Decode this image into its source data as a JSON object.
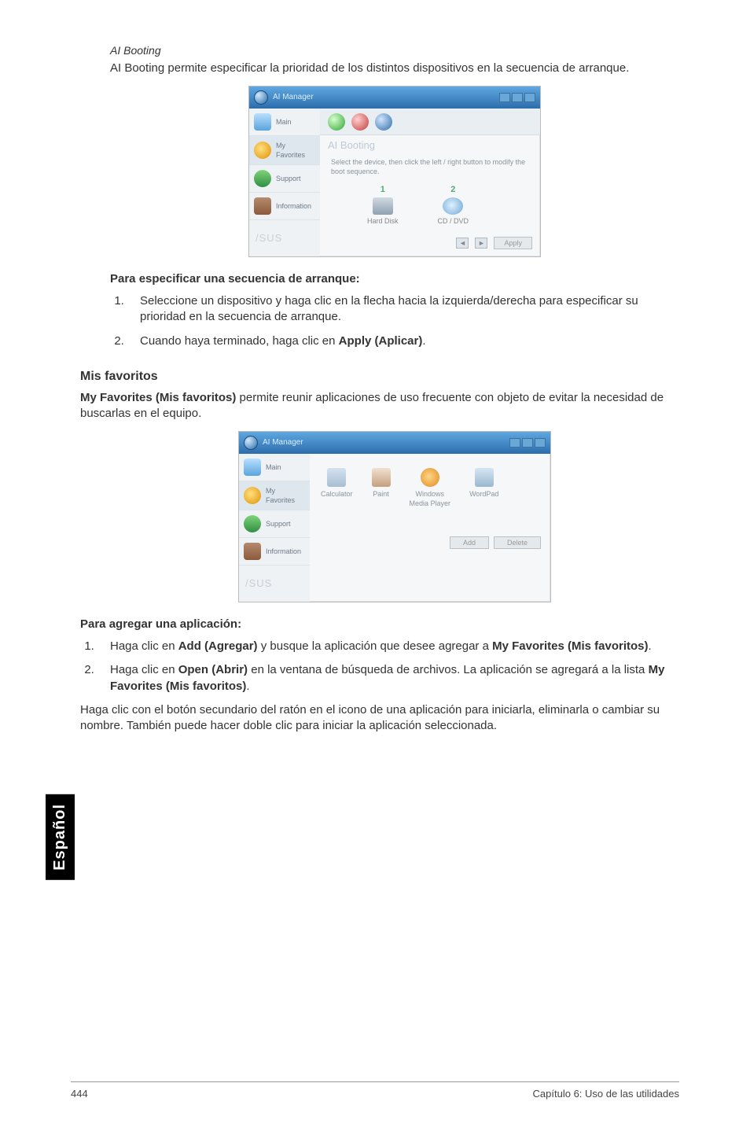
{
  "ai_booting": {
    "heading": "AI Booting",
    "intro": "AI Booting permite especificar la prioridad de los distintos dispositivos en la secuencia de arranque.",
    "figure": {
      "window_title": "AI Manager",
      "sidebar": {
        "main": "Main",
        "favorites_line1": "My",
        "favorites_line2": "Favorites",
        "support": "Support",
        "information": "Information"
      },
      "brand": "/SUS",
      "panel_title": "AI Booting",
      "hint": "Select the device, then click the left / right button to modify the boot sequence.",
      "col1_num": "1",
      "col2_num": "2",
      "dev1": "Hard Disk",
      "dev2": "CD / DVD",
      "arrow_left": "◄",
      "arrow_right": "►",
      "apply": "Apply"
    },
    "steps_heading": "Para especificar una secuencia de arranque:",
    "step1": "Seleccione un dispositivo y haga clic en la flecha hacia la izquierda/derecha para especificar su prioridad en la secuencia de arranque.",
    "step2_pre": "Cuando haya terminado, haga clic en ",
    "step2_bold": "Apply (Aplicar)",
    "step2_post": "."
  },
  "my_favorites": {
    "heading": "Mis favoritos",
    "intro_bold": "My Favorites (Mis favoritos)",
    "intro_rest": " permite reunir aplicaciones de uso frecuente con objeto de evitar la necesidad de buscarlas en el equipo.",
    "figure": {
      "window_title": "AI Manager",
      "sidebar": {
        "main": "Main",
        "favorites_line1": "My",
        "favorites_line2": "Favorites",
        "support": "Support",
        "information": "Information"
      },
      "brand": "/SUS",
      "items": {
        "calc": "Calculator",
        "paint": "Paint",
        "wmp_line1": "Windows",
        "wmp_line2": "Media Player",
        "wordpad": "WordPad"
      },
      "btn_add": "Add",
      "btn_delete": "Delete"
    },
    "add_heading": "Para agregar una aplicación:",
    "step1_pre": "Haga clic en ",
    "step1_bold1": "Add (Agregar)",
    "step1_mid": " y busque la aplicación que desee agregar a ",
    "step1_bold2": "My Favorites (Mis favoritos)",
    "step1_post": ".",
    "step2_pre": "Haga clic en ",
    "step2_bold1": "Open (Abrir)",
    "step2_mid": " en la ventana de búsqueda de archivos. La aplicación se agregará a la lista ",
    "step2_bold2": "My Favorites (Mis favoritos)",
    "step2_post": ".",
    "closing": "Haga clic con el botón secundario del ratón en el icono de una aplicación para iniciarla, eliminarla o cambiar su nombre. También puede hacer doble clic para iniciar la aplicación seleccionada."
  },
  "side_tab": "Español",
  "footer": {
    "page": "444",
    "chapter": "Capítulo 6: Uso de las utilidades"
  }
}
